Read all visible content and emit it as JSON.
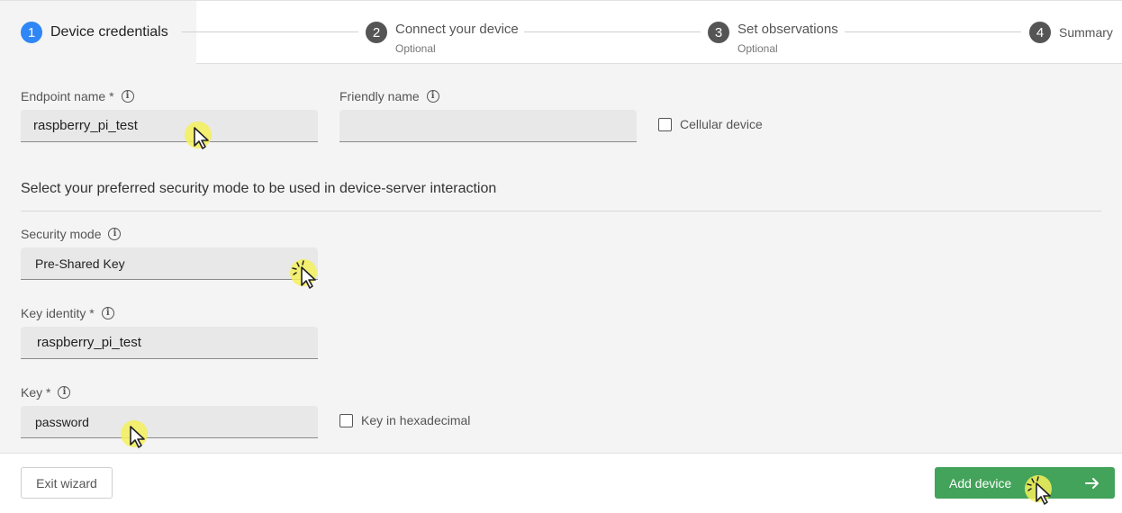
{
  "stepper": {
    "steps": [
      {
        "num": "1",
        "title": "Device credentials",
        "sub": ""
      },
      {
        "num": "2",
        "title": "Connect your device",
        "sub": "Optional"
      },
      {
        "num": "3",
        "title": "Set observations",
        "sub": "Optional"
      },
      {
        "num": "4",
        "title": "Summary",
        "sub": ""
      }
    ],
    "active_index": 0,
    "active_color": "#2f86f6"
  },
  "form": {
    "endpoint_name": {
      "label": "Endpoint name *",
      "value": "raspberry_pi_test"
    },
    "friendly_name": {
      "label": "Friendly name",
      "value": ""
    },
    "cellular": {
      "label": "Cellular device",
      "checked": false
    },
    "security_section_title": "Select your preferred security mode to be used in device-server interaction",
    "security_mode": {
      "label": "Security mode",
      "value": "Pre-Shared Key"
    },
    "key_identity": {
      "label": "Key identity *",
      "value": "raspberry_pi_test"
    },
    "key": {
      "label": "Key *",
      "value": "password"
    },
    "key_hex": {
      "label": "Key in hexadecimal",
      "checked": false
    }
  },
  "footer": {
    "exit_label": "Exit wizard",
    "add_label": "Add device",
    "add_color": "#43a35a"
  },
  "icons": {
    "info": "info-icon",
    "arrow": "arrow-right-icon",
    "cursor": "cursor-pointer-icon"
  }
}
